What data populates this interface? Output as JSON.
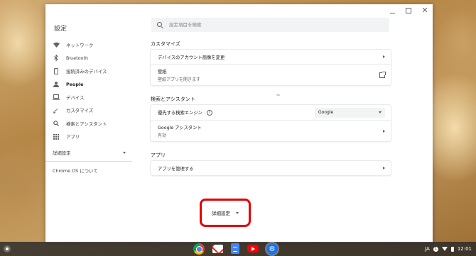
{
  "window": {
    "title": "設定",
    "search_placeholder": "設定項目を検索",
    "controls": {
      "minimize": "–",
      "maximize": "",
      "close": "✕"
    }
  },
  "sidebar": {
    "items": [
      {
        "label": "ネットワーク",
        "icon": "wifi-icon",
        "active": false
      },
      {
        "label": "Bluetooth",
        "icon": "bluetooth-icon",
        "active": false
      },
      {
        "label": "接続済みのデバイス",
        "icon": "phone-icon",
        "active": false
      },
      {
        "label": "People",
        "icon": "person-icon",
        "active": true
      },
      {
        "label": "デバイス",
        "icon": "laptop-icon",
        "active": false
      },
      {
        "label": "カスタマイズ",
        "icon": "brush-icon",
        "active": false
      },
      {
        "label": "検索とアシスタント",
        "icon": "search-icon",
        "active": false
      },
      {
        "label": "アプリ",
        "icon": "apps-grid-icon",
        "active": false
      }
    ],
    "advanced": "詳細設定",
    "about": "Chrome OS について"
  },
  "main": {
    "customize": {
      "title": "カスタマイズ",
      "rows": [
        {
          "label": "デバイスのアカウント画像を変更"
        },
        {
          "label": "壁紙",
          "sub": "壁紙アプリを開きます"
        }
      ]
    },
    "search": {
      "title": "検索とアシスタント",
      "engine_label": "優先する検索エンジン",
      "engine_value": "Google",
      "assistant_label": "Google アシスタント",
      "assistant_value": "有効"
    },
    "apps": {
      "title": "アプリ",
      "manage_label": "アプリを管理する"
    },
    "advanced_button": "詳細設定"
  },
  "shelf": {
    "apps": [
      "chrome-icon",
      "gmail-icon",
      "docs-icon",
      "youtube-icon",
      "settings-icon"
    ],
    "tray": {
      "ime": "JA",
      "notifications": "1",
      "time": "12:01"
    }
  }
}
